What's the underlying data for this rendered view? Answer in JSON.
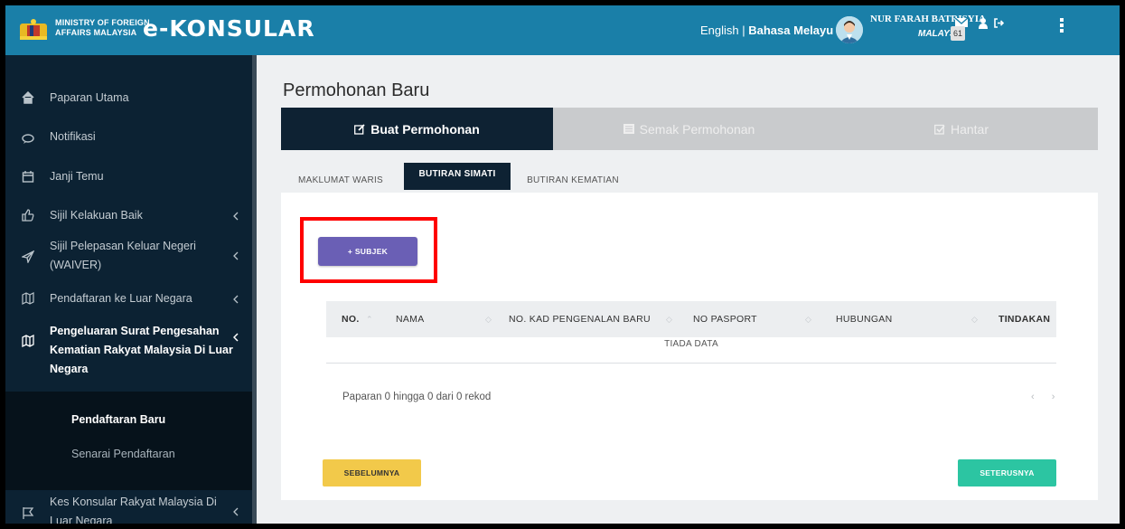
{
  "header": {
    "ministry_line1": "MINISTRY OF FOREIGN",
    "ministry_line2": "AFFAIRS MALAYSIA",
    "brand": "e-KONSULAR",
    "lang_english": "English",
    "lang_separator": " | ",
    "lang_malay": "Bahasa Melayu",
    "user_name": "NUR FARAH BATRISYIA",
    "user_country": "MALAYSIA",
    "notification_count": "61",
    "icons": [
      "crest-logo",
      "user-avatar",
      "mail-icon",
      "person-icon",
      "logout-icon",
      "kebab-menu-icon"
    ]
  },
  "sidebar": {
    "items": [
      {
        "label": "Paparan Utama",
        "icon": "home-icon"
      },
      {
        "label": "Notifikasi",
        "icon": "notification-icon"
      },
      {
        "label": "Janji Temu",
        "icon": "calendar-icon"
      },
      {
        "label": "Sijil Kelakuan Baik",
        "icon": "thumbs-up-icon"
      },
      {
        "label_line1": "Sijil Pelepasan Keluar Negeri",
        "label_line2": "(WAIVER)",
        "icon": "paper-plane-icon"
      },
      {
        "label": "Pendaftaran ke Luar Negara",
        "icon": "map-icon"
      },
      {
        "label_line1": "Pengeluaran Surat Pengesahan",
        "label_line2": "Kematian Rakyat Malaysia Di Luar",
        "label_line3": "Negara",
        "icon": "map-icon"
      },
      {
        "label_line1": "Kes Konsular Rakyat Malaysia Di",
        "label_line2": "Luar Negara",
        "icon": "flag-icon"
      }
    ],
    "submenu": [
      {
        "label": "Pendaftaran Baru"
      },
      {
        "label": "Senarai Pendaftaran"
      }
    ]
  },
  "main": {
    "title": "Permohonan Baru",
    "steps": [
      {
        "label": "Buat Permohonan",
        "icon": "edit-icon"
      },
      {
        "label": "Semak Permohonan",
        "icon": "list-icon"
      },
      {
        "label": "Hantar",
        "icon": "check-square-icon"
      }
    ],
    "tabs": [
      {
        "label": "MAKLUMAT WARIS"
      },
      {
        "label": "BUTIRAN SIMATI"
      },
      {
        "label": "BUTIRAN KEMATIAN"
      }
    ],
    "add_button": "+ SUBJEK",
    "table": {
      "columns": [
        "NO.",
        "NAMA",
        "NO. KAD PENGENALAN BARU",
        "NO PASPORT",
        "HUBUNGAN",
        "TINDAKAN"
      ],
      "empty_text": "TIADA DATA",
      "paging_text": "Paparan 0 hingga 0 dari 0 rekod",
      "pager": "‹ ›"
    },
    "prev_button": "SEBELUMNYA",
    "next_button": "SETERUSNYA"
  },
  "colors": {
    "header": "#1a7fa8",
    "sidebar": "#0c2233",
    "active_step": "#0e2233",
    "subjek_button": "#6a5fb5",
    "prev_button": "#f2c94a",
    "next_button": "#2cc5a2",
    "highlight": "#ff0000"
  }
}
